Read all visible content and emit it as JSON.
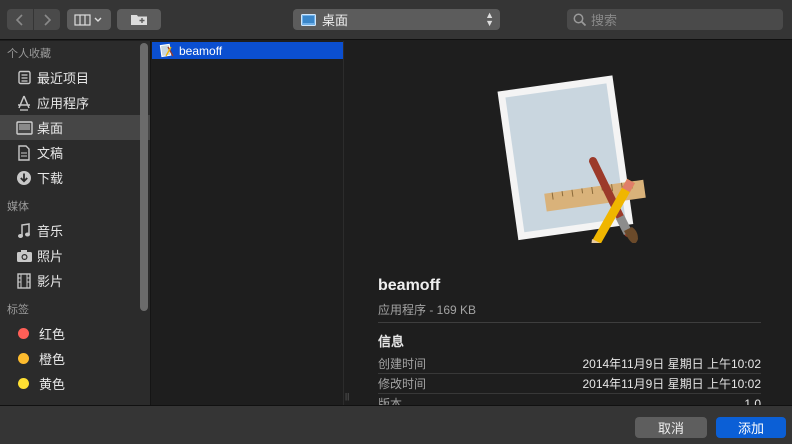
{
  "toolbar": {
    "location": "桌面",
    "search_placeholder": "搜索"
  },
  "sidebar": {
    "favorites_title": "个人收藏",
    "favorites": [
      {
        "label": "最近项目",
        "icon": "recents-icon"
      },
      {
        "label": "应用程序",
        "icon": "applications-icon"
      },
      {
        "label": "桌面",
        "icon": "desktop-icon",
        "selected": true
      },
      {
        "label": "文稿",
        "icon": "documents-icon"
      },
      {
        "label": "下载",
        "icon": "downloads-icon"
      }
    ],
    "media_title": "媒体",
    "media": [
      {
        "label": "音乐",
        "icon": "music-icon"
      },
      {
        "label": "照片",
        "icon": "photos-icon"
      },
      {
        "label": "影片",
        "icon": "movies-icon"
      }
    ],
    "tags_title": "标签",
    "tags": [
      {
        "label": "红色",
        "color": "#ff5f57"
      },
      {
        "label": "橙色",
        "color": "#febc2e"
      },
      {
        "label": "黄色",
        "color": "#ffe033"
      }
    ]
  },
  "column": {
    "files": [
      {
        "name": "beamoff",
        "icon": "app-icon",
        "selected": true
      }
    ]
  },
  "preview": {
    "name": "beamoff",
    "kind_size": "应用程序 - 169 KB",
    "info_title": "信息",
    "rows": [
      {
        "key": "创建时间",
        "value": "2014年11月9日 星期日 上午10:02"
      },
      {
        "key": "修改时间",
        "value": "2014年11月9日 星期日 上午10:02"
      },
      {
        "key": "版本",
        "value": "1.0"
      }
    ]
  },
  "footer": {
    "cancel_label": "取消",
    "add_label": "添加"
  },
  "colors": {
    "accent": "#0b5fd6",
    "selection": "#0b4fd0"
  }
}
